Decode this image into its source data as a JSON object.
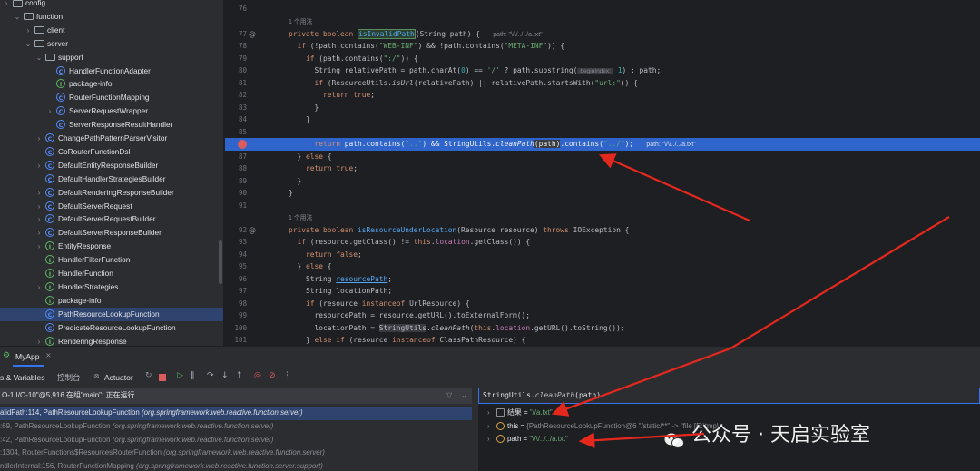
{
  "colors": {
    "accent": "#3574f0",
    "breakpoint": "#db5c5c",
    "arrow": "#e5281e",
    "keyword": "#cf8e6d",
    "string": "#6aab73"
  },
  "tree": {
    "items": [
      {
        "icon": "folder-icon",
        "label": "config",
        "indent": 0,
        "arrow": "›"
      },
      {
        "icon": "folder-icon",
        "label": "function",
        "indent": 1,
        "arrow": "⌄"
      },
      {
        "icon": "folder-icon",
        "label": "client",
        "indent": 2,
        "arrow": "›"
      },
      {
        "icon": "folder-icon",
        "label": "server",
        "indent": 2,
        "arrow": "⌄"
      },
      {
        "icon": "folder-icon",
        "label": "support",
        "indent": 3,
        "arrow": "⌄"
      },
      {
        "icon": "class-icon",
        "label": "HandlerFunctionAdapter",
        "indent": 4,
        "arrow": ""
      },
      {
        "icon": "package-info-icon",
        "label": "package-info",
        "indent": 4,
        "arrow": ""
      },
      {
        "icon": "class-icon",
        "label": "RouterFunctionMapping",
        "indent": 4,
        "arrow": ""
      },
      {
        "icon": "class-icon",
        "label": "ServerRequestWrapper",
        "indent": 4,
        "arrow": "›"
      },
      {
        "icon": "class-icon",
        "label": "ServerResponseResultHandler",
        "indent": 4,
        "arrow": ""
      },
      {
        "icon": "class-icon",
        "label": "ChangePathPatternParserVisitor",
        "indent": 3,
        "arrow": "›"
      },
      {
        "icon": "class-icon",
        "label": "CoRouterFunctionDsl",
        "indent": 3,
        "arrow": ""
      },
      {
        "icon": "class-icon",
        "label": "DefaultEntityResponseBuilder",
        "indent": 3,
        "arrow": "›"
      },
      {
        "icon": "class-icon",
        "label": "DefaultHandlerStrategiesBuilder",
        "indent": 3,
        "arrow": ""
      },
      {
        "icon": "class-icon",
        "label": "DefaultRenderingResponseBuilder",
        "indent": 3,
        "arrow": "›"
      },
      {
        "icon": "class-icon",
        "label": "DefaultServerRequest",
        "indent": 3,
        "arrow": "›"
      },
      {
        "icon": "class-icon",
        "label": "DefaultServerRequestBuilder",
        "indent": 3,
        "arrow": "›"
      },
      {
        "icon": "class-icon",
        "label": "DefaultServerResponseBuilder",
        "indent": 3,
        "arrow": "›"
      },
      {
        "icon": "info-icon",
        "label": "EntityResponse",
        "indent": 3,
        "arrow": "›"
      },
      {
        "icon": "info-icon",
        "label": "HandlerFilterFunction",
        "indent": 3,
        "arrow": ""
      },
      {
        "icon": "info-icon",
        "label": "HandlerFunction",
        "indent": 3,
        "arrow": ""
      },
      {
        "icon": "info-icon",
        "label": "HandlerStrategies",
        "indent": 3,
        "arrow": "›"
      },
      {
        "icon": "package-info-icon",
        "label": "package-info",
        "indent": 3,
        "arrow": ""
      },
      {
        "icon": "class-icon",
        "label": "PathResourceLookupFunction",
        "indent": 3,
        "arrow": "",
        "selected": true
      },
      {
        "icon": "class-icon",
        "label": "PredicateResourceLookupFunction",
        "indent": 3,
        "arrow": ""
      },
      {
        "icon": "info-icon",
        "label": "RenderingResponse",
        "indent": 3,
        "arrow": "›"
      }
    ]
  },
  "editor": {
    "usages_label": "1 个用法",
    "lines": [
      {
        "no": "76"
      },
      {
        "no": "",
        "usage": true
      },
      {
        "no": "77",
        "mark": "@"
      },
      {
        "no": "78"
      },
      {
        "no": "79"
      },
      {
        "no": "80"
      },
      {
        "no": "81"
      },
      {
        "no": "82"
      },
      {
        "no": "83"
      },
      {
        "no": "84"
      },
      {
        "no": "85"
      },
      {
        "no": "86",
        "bp": true
      },
      {
        "no": "87"
      },
      {
        "no": "88"
      },
      {
        "no": "89"
      },
      {
        "no": "90"
      },
      {
        "no": "91"
      },
      {
        "no": "",
        "usage": true
      },
      {
        "no": "92",
        "mark": "@"
      },
      {
        "no": "93"
      },
      {
        "no": "94"
      },
      {
        "no": "95"
      },
      {
        "no": "96"
      },
      {
        "no": "97"
      },
      {
        "no": "98"
      },
      {
        "no": "99"
      },
      {
        "no": "100"
      },
      {
        "no": "101"
      },
      {
        "no": "102"
      }
    ],
    "code": {
      "l77a": "private boolean ",
      "l77b": "isInvalidPath",
      "l77c": "(String path) {",
      "l77h": "path: \"\\/\\/../../a.txt\"",
      "l78a": "if",
      "l78b": " (!path.contains(",
      "l78c": "\"WEB-INF\"",
      "l78d": ") && !path.contains(",
      "l78e": "\"META-INF\"",
      "l78f": ")) {",
      "l79a": "if",
      "l79b": " (path.contains(",
      "l79c": "\":/\"",
      "l79d": ")) {",
      "l80a": "String relativePath = path.charAt(",
      "l80b": "0",
      "l80c": ") == ",
      "l80d": "'/'",
      "l80e": " ? path.substring(",
      "l80f": "beginIndex:",
      "l80g": "1",
      "l80h": ") : path;",
      "l81a": "if",
      "l81b": " (ResourceUtils.",
      "l81c": "isUrl",
      "l81d": "(relativePath) || relativePath.startsWith(",
      "l81e": "\"url:\"",
      "l81f": ")) {",
      "l82a": "return true",
      "l82b": ";",
      "l83": "}",
      "l84": "}",
      "l86a": "return ",
      "l86b": "path.contains(",
      "l86c": "\"..\"",
      "l86d": ") && StringUtils.",
      "l86e": "cleanPath",
      "l86f": "(path)",
      "l86g": ".contains(",
      "l86h": "\"../\"",
      "l86i": ");",
      "l86j": "path: \"\\/\\/../../a.txt\"",
      "l87a": "} ",
      "l87b": "else",
      "l87c": " {",
      "l88a": "return true",
      "l88b": ";",
      "l89": "}",
      "l90": "}",
      "l92a": "private boolean ",
      "l92b": "isResourceUnderLocation",
      "l92c": "(Resource resource) ",
      "l92d": "throws",
      "l92e": " IOException {",
      "l93a": "if",
      "l93b": " (resource.getClass() != ",
      "l93c": "this",
      "l93d": ".",
      "l93e": "location",
      "l93f": ".getClass()) {",
      "l94a": "return false",
      "l94b": ";",
      "l95a": "} ",
      "l95b": "else",
      "l95c": " {",
      "l96a": "String ",
      "l96b": "resourcePath",
      "l96c": ";",
      "l97": "String locationPath;",
      "l98a": "if",
      "l98b": " (resource ",
      "l98c": "instanceof",
      "l98d": " UrlResource) {",
      "l99": "resourcePath = resource.getURL().toExternalForm();",
      "l100a": "locationPath = ",
      "l100b": "StringUtils",
      "l100c": ".",
      "l100d": "cleanPath",
      "l100e": "(",
      "l100f": "this",
      "l100g": ".",
      "l100h": "location",
      "l100i": ".getURL().toString());",
      "l101a": "} ",
      "l101b": "else if",
      "l101c": " (resource ",
      "l101d": "instanceof",
      "l101e": " ClassPathResource) {"
    }
  },
  "debug": {
    "app_tab": "MyApp",
    "tabs": [
      "s & Variables",
      "控制台",
      "Actuator"
    ],
    "thread": "O-1 I/O-10\"@5,916 在组\"main\": 正在运行",
    "frames": [
      {
        "method": "alidPath:114, PathResourceLookupFunction",
        "pkg": "(org.springframework.web.reactive.function.server)"
      },
      {
        "method": ":69, PathResourceLookupFunction",
        "pkg": "(org.springframework.web.reactive.function.server)"
      },
      {
        "method": ":42, PathResourceLookupFunction",
        "pkg": "(org.springframework.web.reactive.function.server)"
      },
      {
        "method": ":1304, RouterFunctions$ResourcesRouterFunction",
        "pkg": "(org.springframework.web.reactive.function.server)"
      },
      {
        "method": "ndlerInternal:156, RouterFunctionMapping",
        "pkg": "(org.springframework.web.reactive.function.server.support)"
      }
    ],
    "eval_prefix": "StringUtils.",
    "eval_method": "cleanPath",
    "eval_suffix": "(path)",
    "vars": [
      {
        "name": "结果",
        "eq": " = ",
        "value": "\"//a.txt\"",
        "icon": "result-icon"
      },
      {
        "name": "this",
        "eq": " = ",
        "value": "{PathResourceLookupFunction@6",
        "tail": "\"/static/**\" -> \"file [E:\\tmp\\",
        "icon": "field-icon"
      },
      {
        "name": "path",
        "eq": " = ",
        "value": "\"\\/\\/../../a.txt\"",
        "icon": "param-icon"
      }
    ]
  },
  "watermark": {
    "text": "公众号 · 天启实验室"
  }
}
